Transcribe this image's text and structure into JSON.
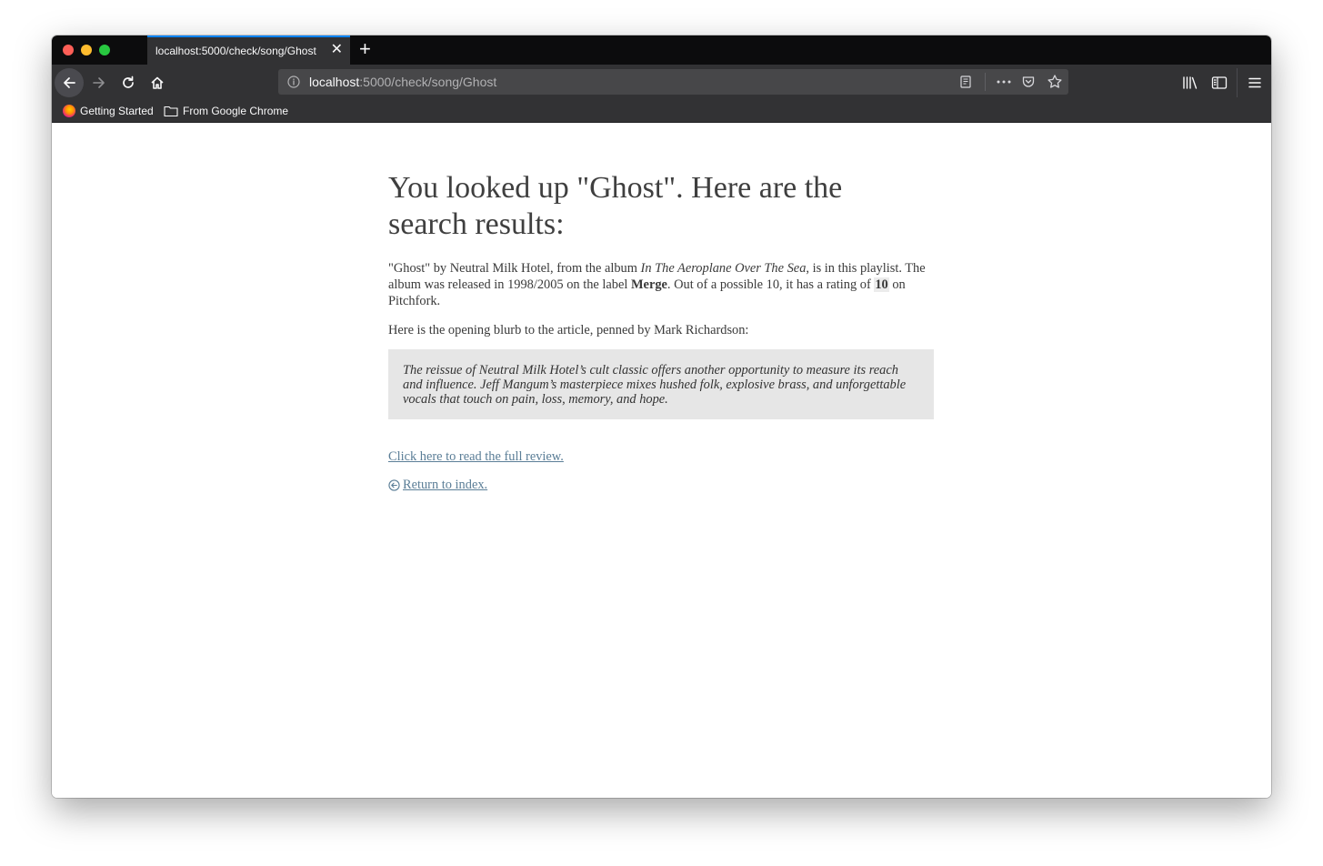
{
  "browser": {
    "tab_title": "localhost:5000/check/song/Ghost",
    "tab_close": "✕",
    "new_tab": "+",
    "url_host": "localhost",
    "url_path": ":5000/check/song/Ghost",
    "bookmarks": [
      {
        "label": "Getting Started",
        "icon": "firefox-logo-icon"
      },
      {
        "label": "From Google Chrome",
        "icon": "folder-icon"
      }
    ]
  },
  "page": {
    "heading": "You looked up \"Ghost\". Here are the search results:",
    "summary": {
      "part1": "\"Ghost\" by Neutral Milk Hotel, from the album ",
      "album": "In The Aeroplane Over The Sea",
      "part2": ", is in this playlist. The album was released in 1998/2005 on the label ",
      "label": "Merge",
      "part3": ". Out of a possible 10, it has a rating of ",
      "rating": "10",
      "part4": " on Pitchfork."
    },
    "blurb_intro": "Here is the opening blurb to the article, penned by Mark Richardson:",
    "blurb": "The reissue of Neutral Milk Hotel’s cult classic offers another opportunity to measure its reach and influence. Jeff Mangum’s masterpiece mixes hushed folk, explosive brass, and unforgettable vocals that touch on pain, loss, memory, and hope.",
    "review_link": "Click here to read the full review.",
    "index_link": "Return to index."
  },
  "colors": {
    "link": "#5b7e97",
    "quote_bg": "#e6e6e6",
    "toolbar_bg": "#323234",
    "tab_accent": "#0a84ff"
  }
}
